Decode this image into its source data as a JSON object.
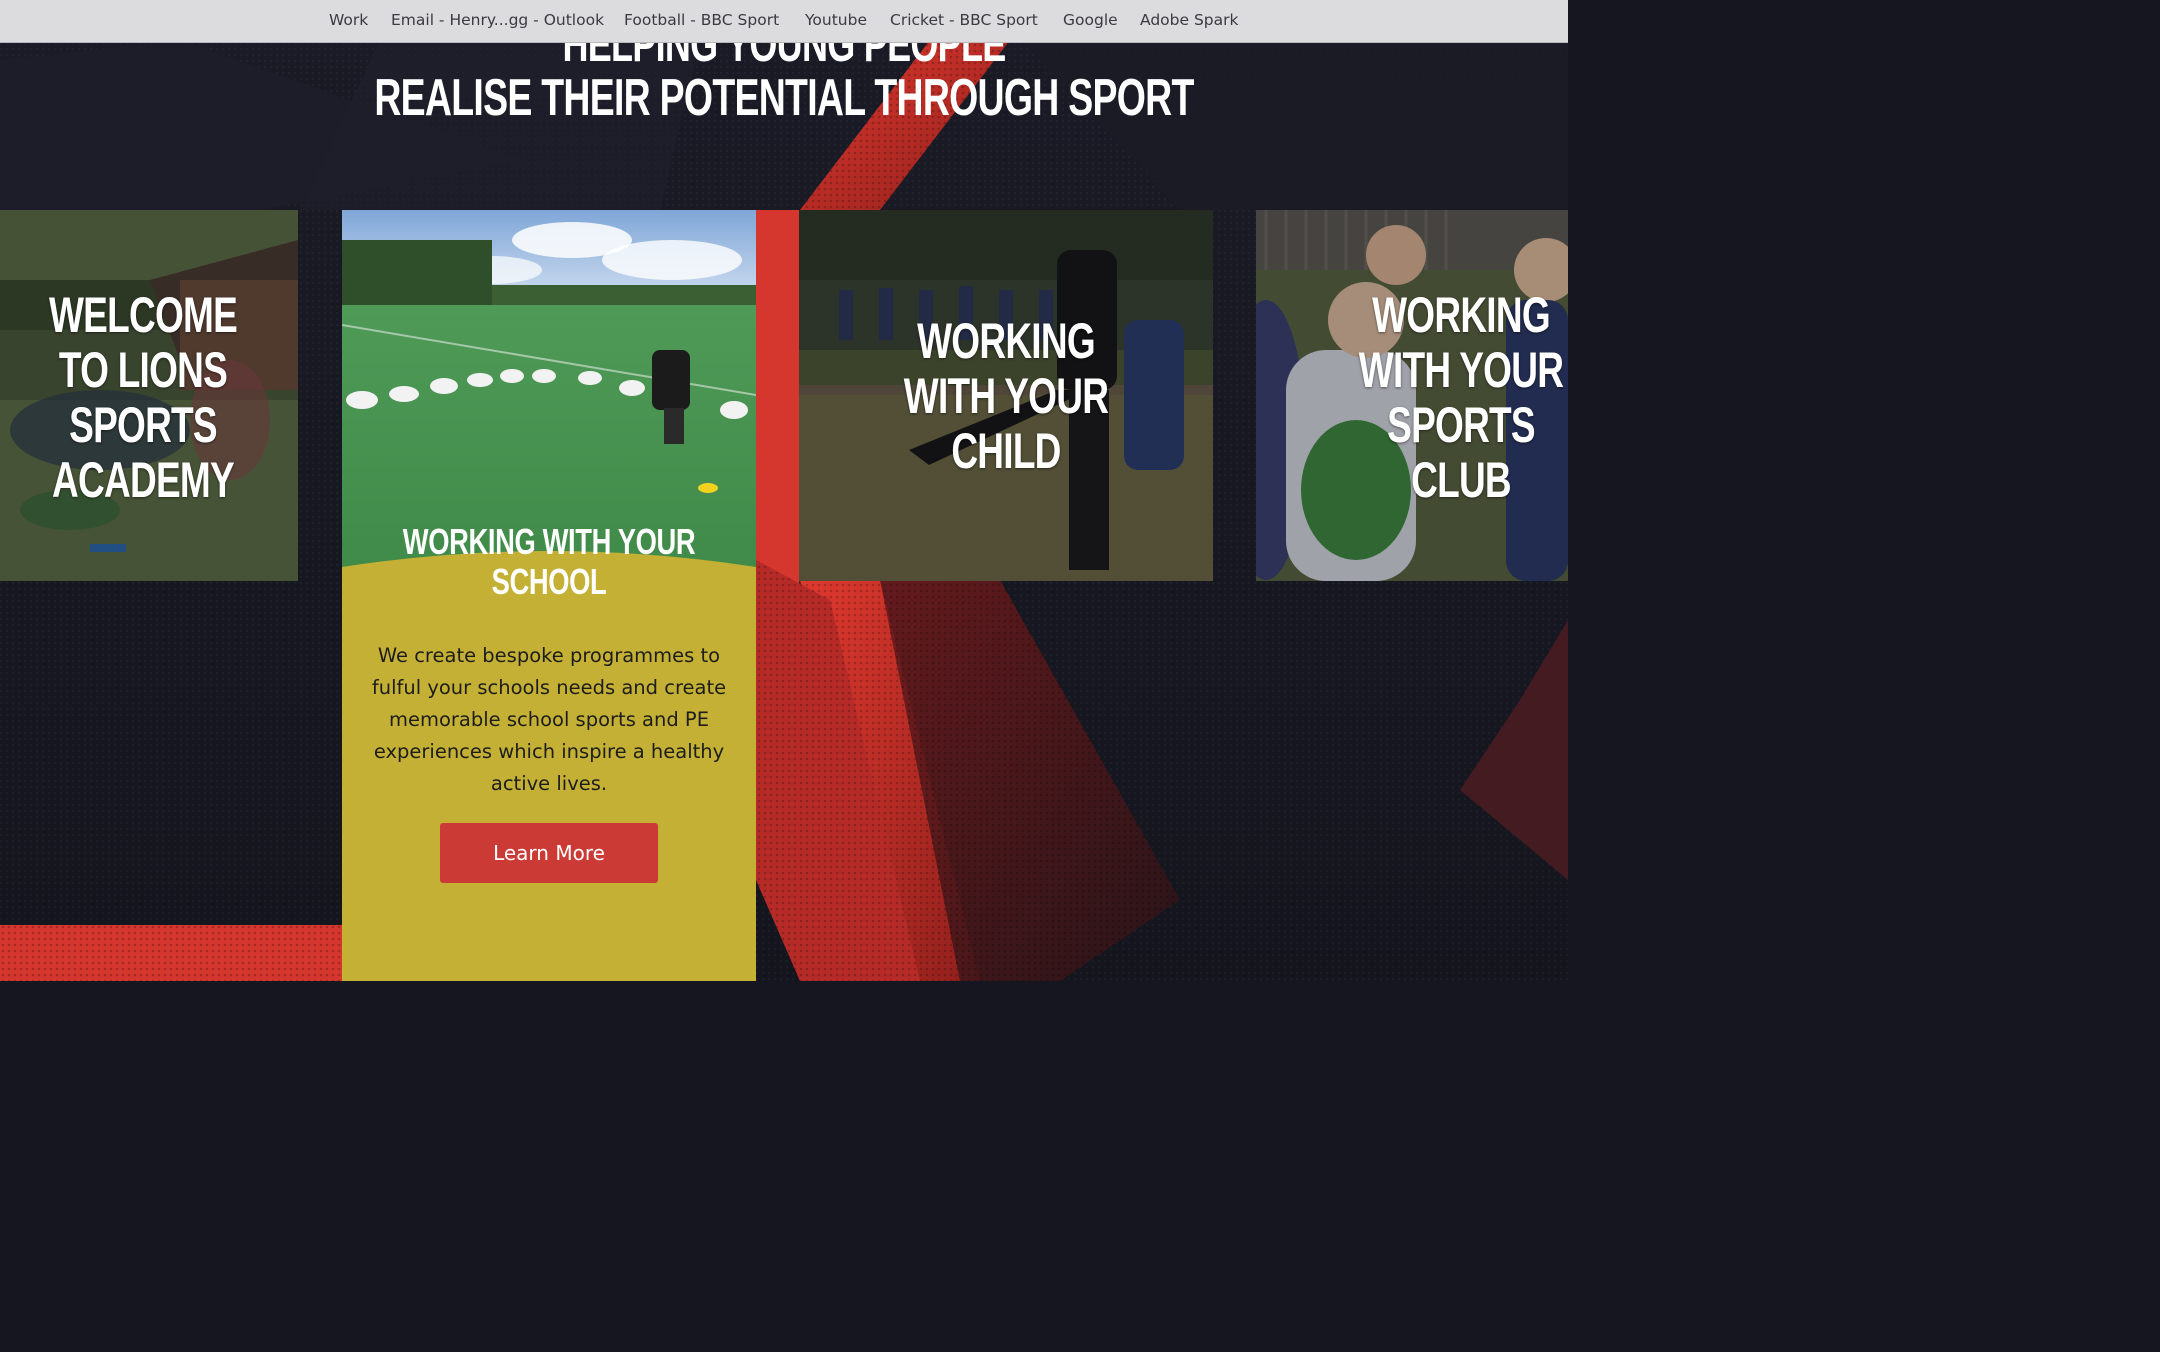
{
  "bookmarks": [
    "Work",
    "Email - Henry...gg - Outlook",
    "Football - BBC Sport",
    "Youtube",
    "Cricket - BBC Sport",
    "Google",
    "Adobe Spark"
  ],
  "hero": {
    "line1": "HELPING YOUNG PEOPLE",
    "line2": "REALISE THEIR POTENTIAL THROUGH SPORT"
  },
  "cards": [
    {
      "title_lines": [
        "WELCOME",
        "TO LIONS",
        "SPORTS",
        "ACADEMY"
      ]
    },
    {
      "title_lines": [
        "WORKING",
        "WITH YOUR",
        "CHILD"
      ]
    },
    {
      "title_lines": [
        "WORKING",
        "WITH YOUR",
        "SPORTS",
        "CLUB"
      ]
    }
  ],
  "feature": {
    "title_lines": [
      "WORKING WITH YOUR",
      "SCHOOL"
    ],
    "description": "We create bespoke programmes to fulful your schools needs and create memorable school sports and PE experiences which inspire a healthy active lives.",
    "button_label": "Learn More"
  },
  "colors": {
    "background": "#15161f",
    "accent_red": "#cc3a35",
    "feature_yellow": "#c4b034",
    "bookmarks_bar": "#dcdcdf"
  }
}
